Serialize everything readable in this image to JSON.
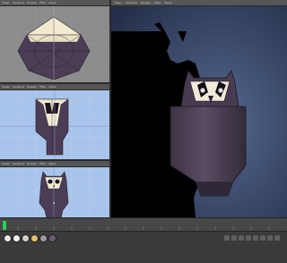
{
  "viewport_menus": [
    "Views",
    "Cameras",
    "Display",
    "Filter",
    "Panel"
  ],
  "perspective_menus": [
    "Views",
    "Cameras",
    "Display",
    "Filter",
    "Panel"
  ],
  "colors": {
    "ui_dark": "#3c3c3c",
    "panel_gray": "#8a8a8a",
    "viewport_blue": "#a9c4ea",
    "perspective_blue": "#3b4c70",
    "model_purple": "#4b3f56",
    "timeline_green": "#28d25a"
  },
  "material_swatches": [
    "#e8e8e8",
    "#f2f2f2",
    "#d3d0c8",
    "#e0c36a",
    "#9b9b9b",
    "#6d5b78"
  ]
}
